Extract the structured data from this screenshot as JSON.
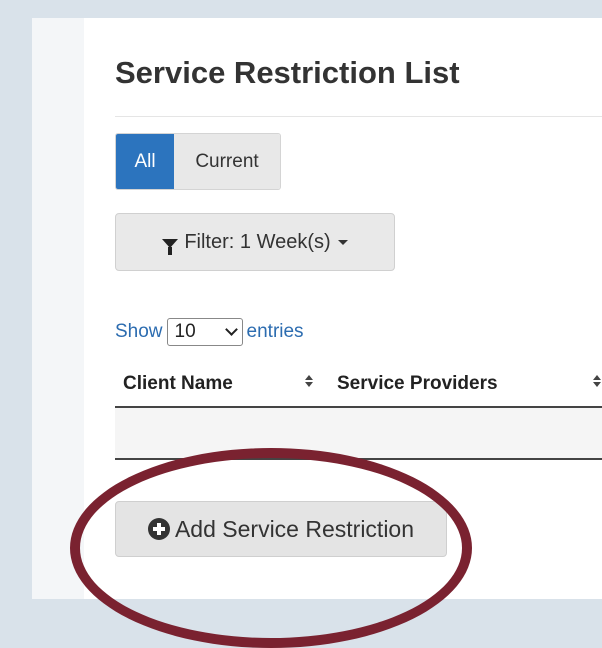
{
  "page": {
    "title": "Service Restriction List"
  },
  "view_toggle": {
    "options": [
      "All",
      "Current"
    ],
    "selected": "All",
    "active_color": "#2c74be"
  },
  "filter": {
    "label": "Filter: 1 Week(s)",
    "icon": "filter-icon"
  },
  "entries": {
    "show_label": "Show",
    "page_size": "10",
    "entries_label": "entries"
  },
  "table": {
    "columns": [
      "Client Name",
      "Service Providers"
    ],
    "rows": []
  },
  "actions": {
    "add_label": "Add Service Restriction",
    "add_icon": "plus-circle-icon"
  },
  "annotation": {
    "color": "#7a2230"
  }
}
